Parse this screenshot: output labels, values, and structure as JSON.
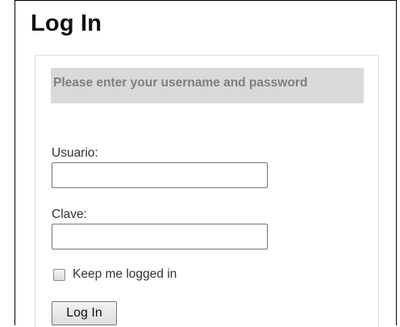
{
  "page": {
    "title": "Log In"
  },
  "login": {
    "banner_text": "Please enter your username and password",
    "username": {
      "label": "Usuario:",
      "value": "",
      "placeholder": ""
    },
    "password": {
      "label": "Clave:",
      "value": "",
      "placeholder": ""
    },
    "remember_me": {
      "label": "Keep me logged in",
      "checked": false
    },
    "submit_label": "Log In"
  },
  "colors": {
    "banner_background": "#d9d9d9",
    "banner_text": "#7f7f7f",
    "text": "#333333",
    "panel_border": "#e0e0e0"
  }
}
